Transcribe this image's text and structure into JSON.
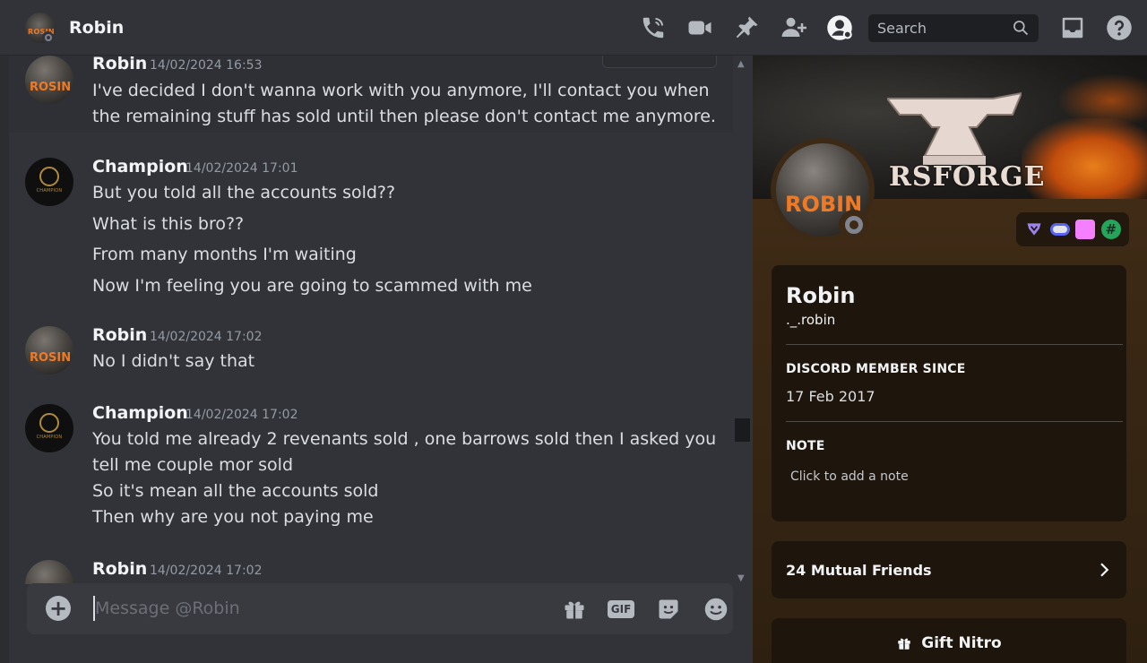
{
  "header": {
    "title": "Robin",
    "avatar_tag": "ROSIN",
    "tools": [
      "phone-call-icon",
      "video-call-icon",
      "pin-icon",
      "add-friend-icon",
      "user-profile-icon"
    ],
    "search_placeholder": "Search",
    "extra_tools": [
      "inbox-icon",
      "help-icon"
    ]
  },
  "messages": [
    {
      "author": "Robin",
      "avatar": "robin",
      "timestamp": "14/02/2024 16:53",
      "lines": [
        "I've decided I don't wanna work with you anymore, I'll contact you when",
        "the remaining stuff has sold until then please don't contact me anymore."
      ]
    },
    {
      "author": "Champion",
      "avatar": "champion",
      "timestamp": "14/02/2024 17:01",
      "lines": [
        "But you told all the accounts sold??",
        "What is this bro??",
        "From many months I'm waiting",
        "Now I'm feeling you are going to scammed with me"
      ]
    },
    {
      "author": "Robin",
      "avatar": "robin",
      "timestamp": "14/02/2024 17:02",
      "lines": [
        "No I didn't say that"
      ]
    },
    {
      "author": "Champion",
      "avatar": "champion",
      "timestamp": "14/02/2024 17:02",
      "lines": [
        "You told me already 2 revenants sold , one barrows sold then I asked you",
        "tell me couple mor sold",
        "So it's mean all the accounts sold",
        "Then why are you not paying me"
      ]
    },
    {
      "author": "Robin",
      "avatar": "robin",
      "timestamp": "14/02/2024 17:02",
      "lines": []
    }
  ],
  "composer": {
    "placeholder": "Message @Robin",
    "gif_label": "GIF"
  },
  "profile": {
    "banner_text": "RSFORGE",
    "avatar_tag": "ROBIN",
    "display_name": "Robin",
    "username": "._.robin",
    "member_since_title": "DISCORD MEMBER SINCE",
    "member_since_value": "17 Feb 2017",
    "note_title": "NOTE",
    "note_placeholder": "Click to add a note",
    "mutual_friends": "24 Mutual Friends",
    "gift_label": "Gift Nitro",
    "badges": [
      "hypesquad-badge",
      "nitro-badge",
      "nitro-boost-badge",
      "quest-badge"
    ],
    "badge_hash": "#",
    "status_color": "#80848e"
  },
  "colors": {
    "background": "#313338",
    "panel": "#3c2915",
    "accent": "#5865f2"
  }
}
